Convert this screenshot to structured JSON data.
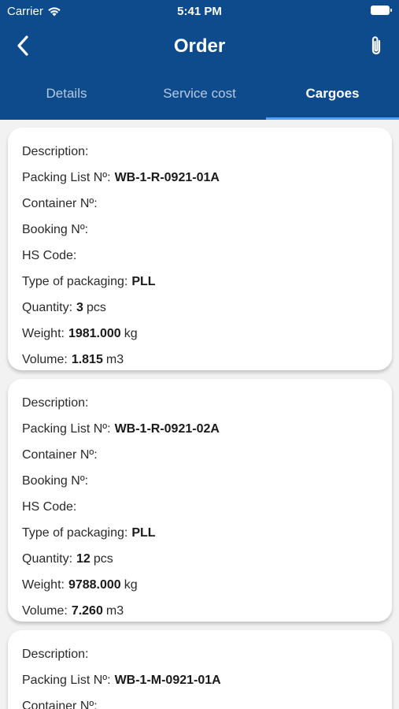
{
  "status_bar": {
    "carrier": "Carrier",
    "time": "5:41 PM"
  },
  "header": {
    "title": "Order"
  },
  "tabs": [
    {
      "label": "Details",
      "active": false
    },
    {
      "label": "Service cost",
      "active": false
    },
    {
      "label": "Cargoes",
      "active": true
    }
  ],
  "labels": {
    "description": "Description:",
    "packing_list": "Packing List Nº:",
    "container": "Container Nº:",
    "booking": "Booking Nº:",
    "hs_code": "HS Code:",
    "packaging": "Type of packaging:",
    "quantity": "Quantity:",
    "weight": "Weight:",
    "volume": "Volume:"
  },
  "cargoes": [
    {
      "description": "",
      "packing_list": "WB-1-R-0921-01A",
      "container": "",
      "booking": "",
      "hs_code": "",
      "packaging": "PLL",
      "quantity": "3",
      "quantity_unit": "pcs",
      "weight": "1981.000",
      "weight_unit": "kg",
      "volume": "1.815",
      "volume_unit": "m3"
    },
    {
      "description": "",
      "packing_list": "WB-1-R-0921-02A",
      "container": "",
      "booking": "",
      "hs_code": "",
      "packaging": "PLL",
      "quantity": "12",
      "quantity_unit": "pcs",
      "weight": "9788.000",
      "weight_unit": "kg",
      "volume": "7.260",
      "volume_unit": "m3"
    },
    {
      "description": "",
      "packing_list": "WB-1-M-0921-01A",
      "container": ""
    }
  ],
  "colors": {
    "header_bg": "#0d4b8c",
    "tab_indicator": "#4da3ff",
    "page_bg": "#f2f2f2"
  },
  "icons": {
    "back": "chevron-left-icon",
    "attach": "paperclip-icon",
    "wifi": "wifi-icon",
    "battery": "battery-icon"
  }
}
